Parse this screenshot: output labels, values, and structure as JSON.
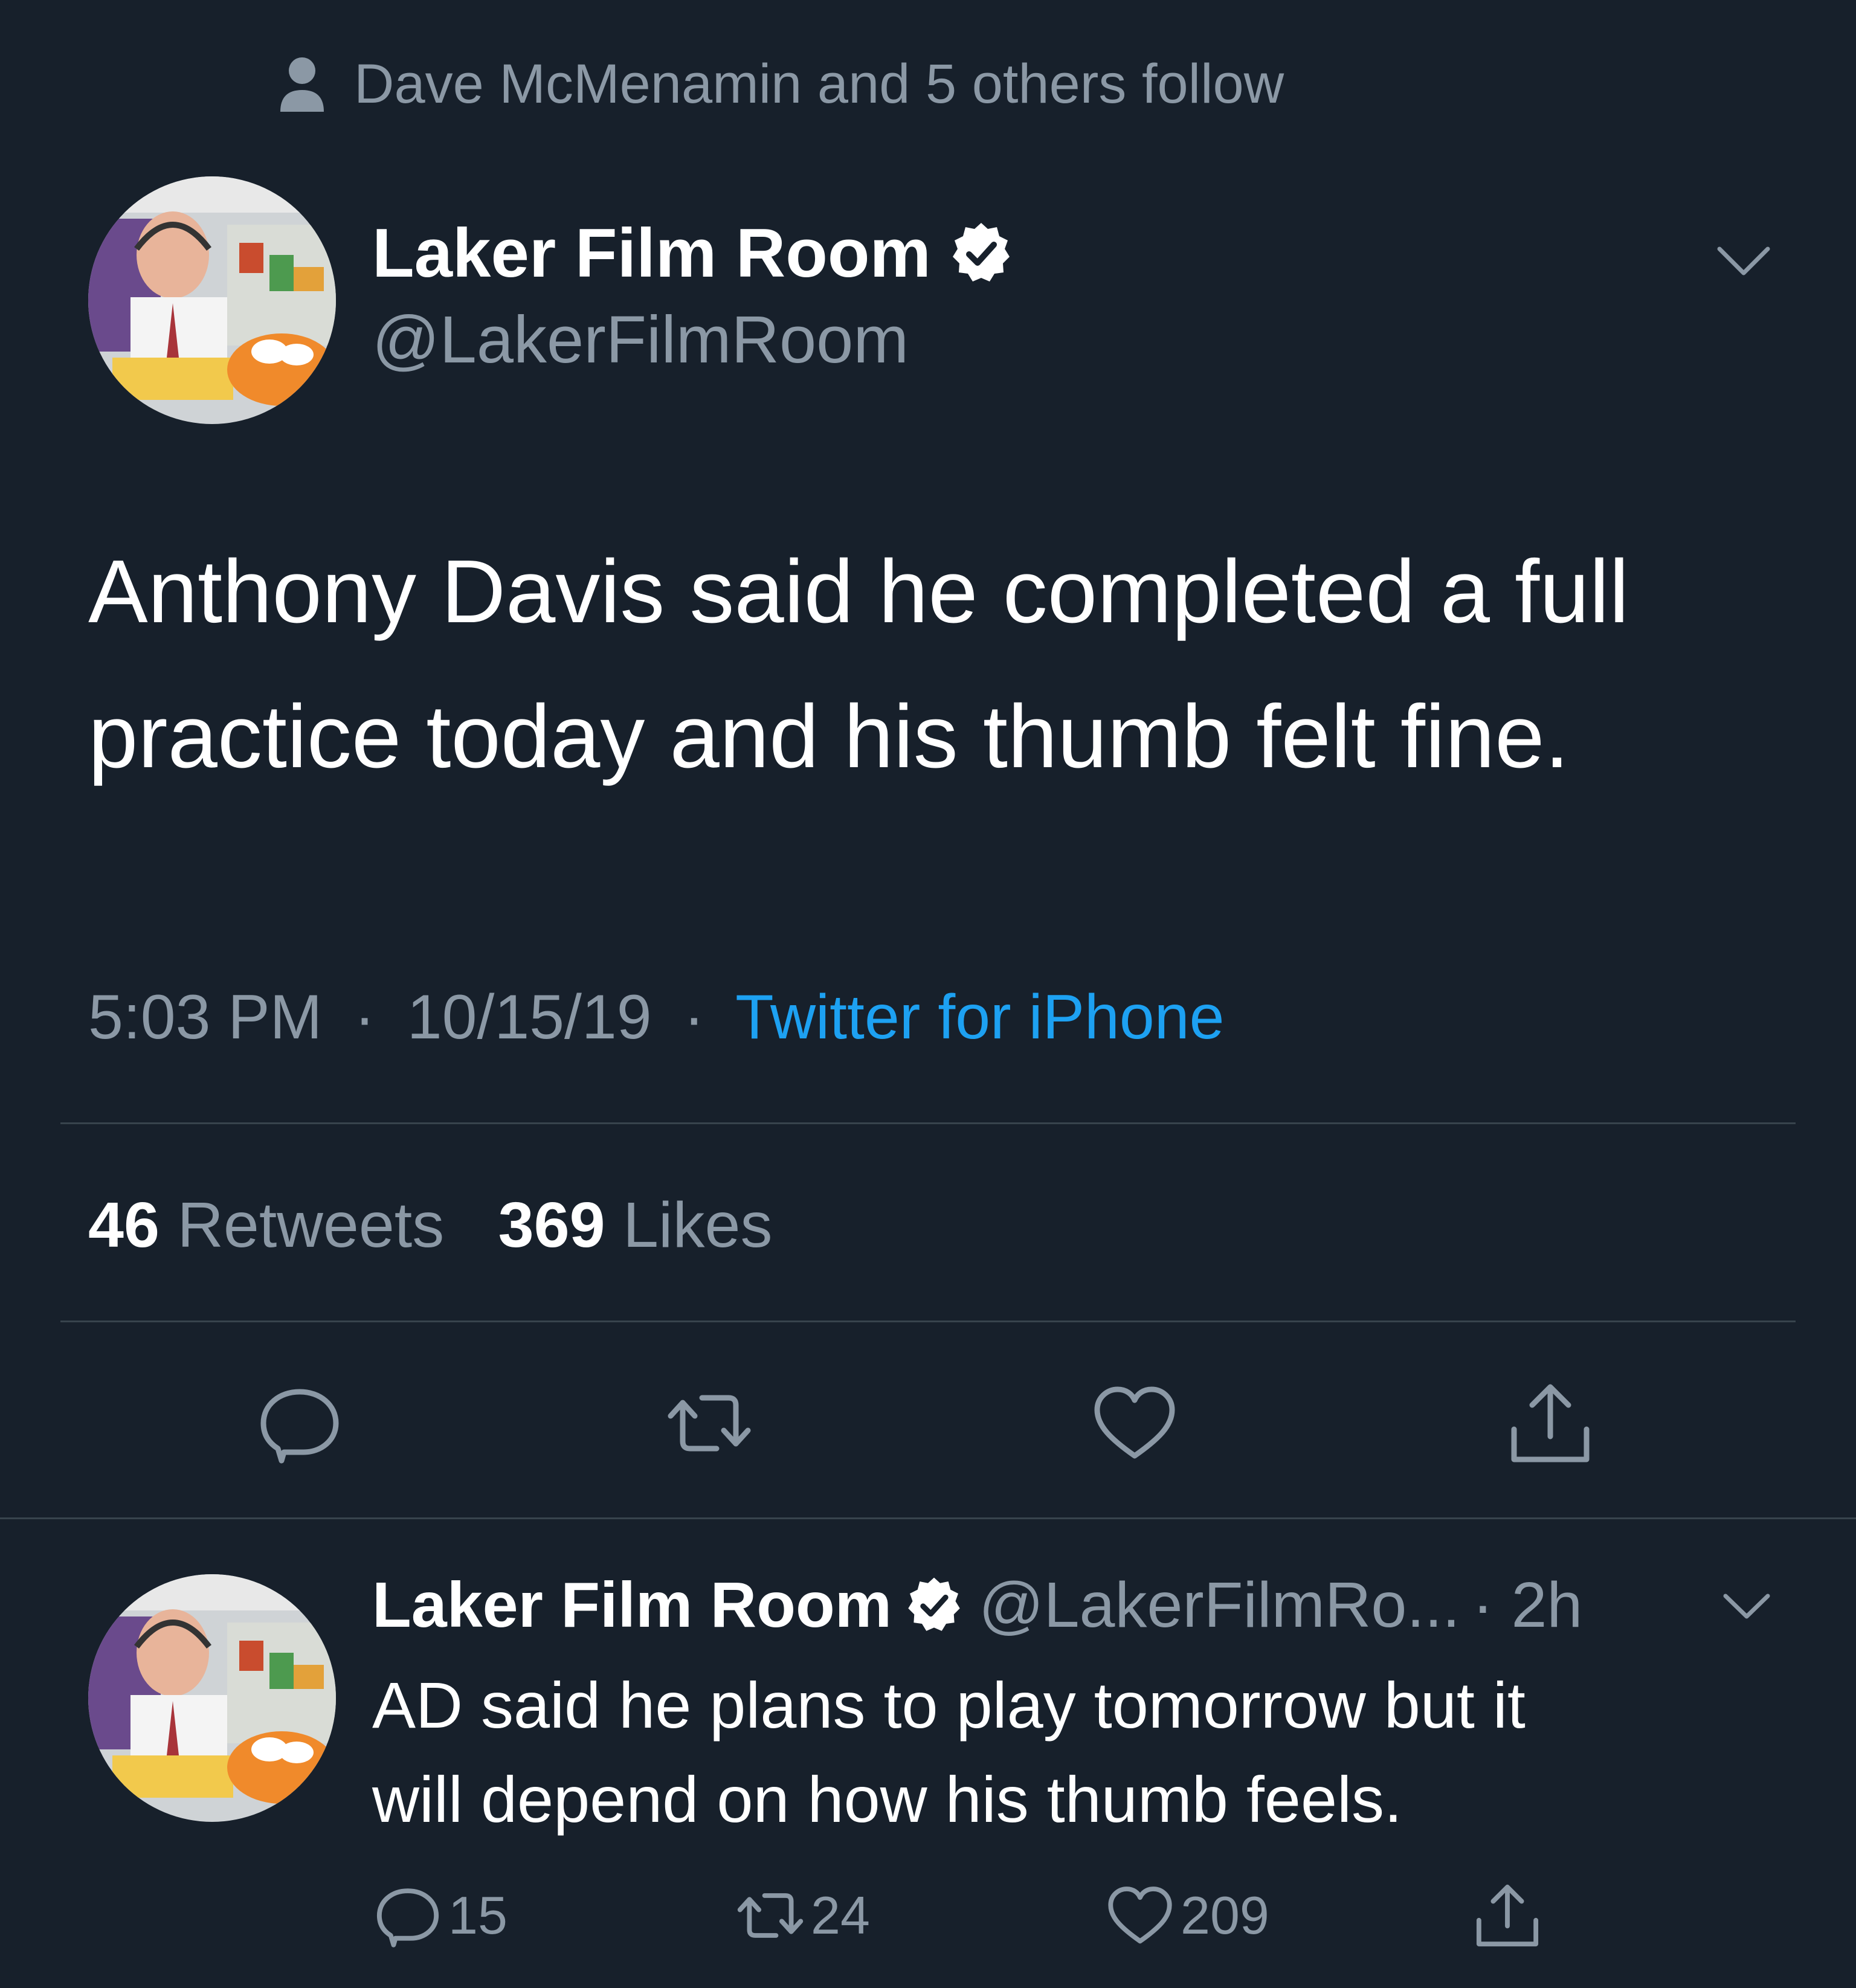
{
  "context": {
    "text": "Dave McMenamin and 5 others follow",
    "icon": "person-icon"
  },
  "main_tweet": {
    "display_name": "Laker Film Room",
    "handle": "@LakerFilmRoom",
    "verified": true,
    "text_line1": "Anthony Davis said he completed a full",
    "text_line2": "practice today and his thumb felt fine.",
    "time": "5:03 PM",
    "separator": "·",
    "date": "10/15/19",
    "source": "Twitter for iPhone",
    "retweets_count": "46",
    "retweets_label": "Retweets",
    "likes_count": "369",
    "likes_label": "Likes"
  },
  "reply_tweet": {
    "display_name": "Laker Film Room",
    "handle": "@LakerFilmRo...",
    "time_ago": "· 2h",
    "verified": true,
    "text_line1": "AD said he plans to play tomorrow but it",
    "text_line2": "will depend on how his thumb feels.",
    "replies": "15",
    "retweets": "24",
    "likes": "209"
  },
  "colors": {
    "background": "#17202b",
    "muted": "#8b98a5",
    "accent": "#1da1f2",
    "divider": "#38444d"
  }
}
